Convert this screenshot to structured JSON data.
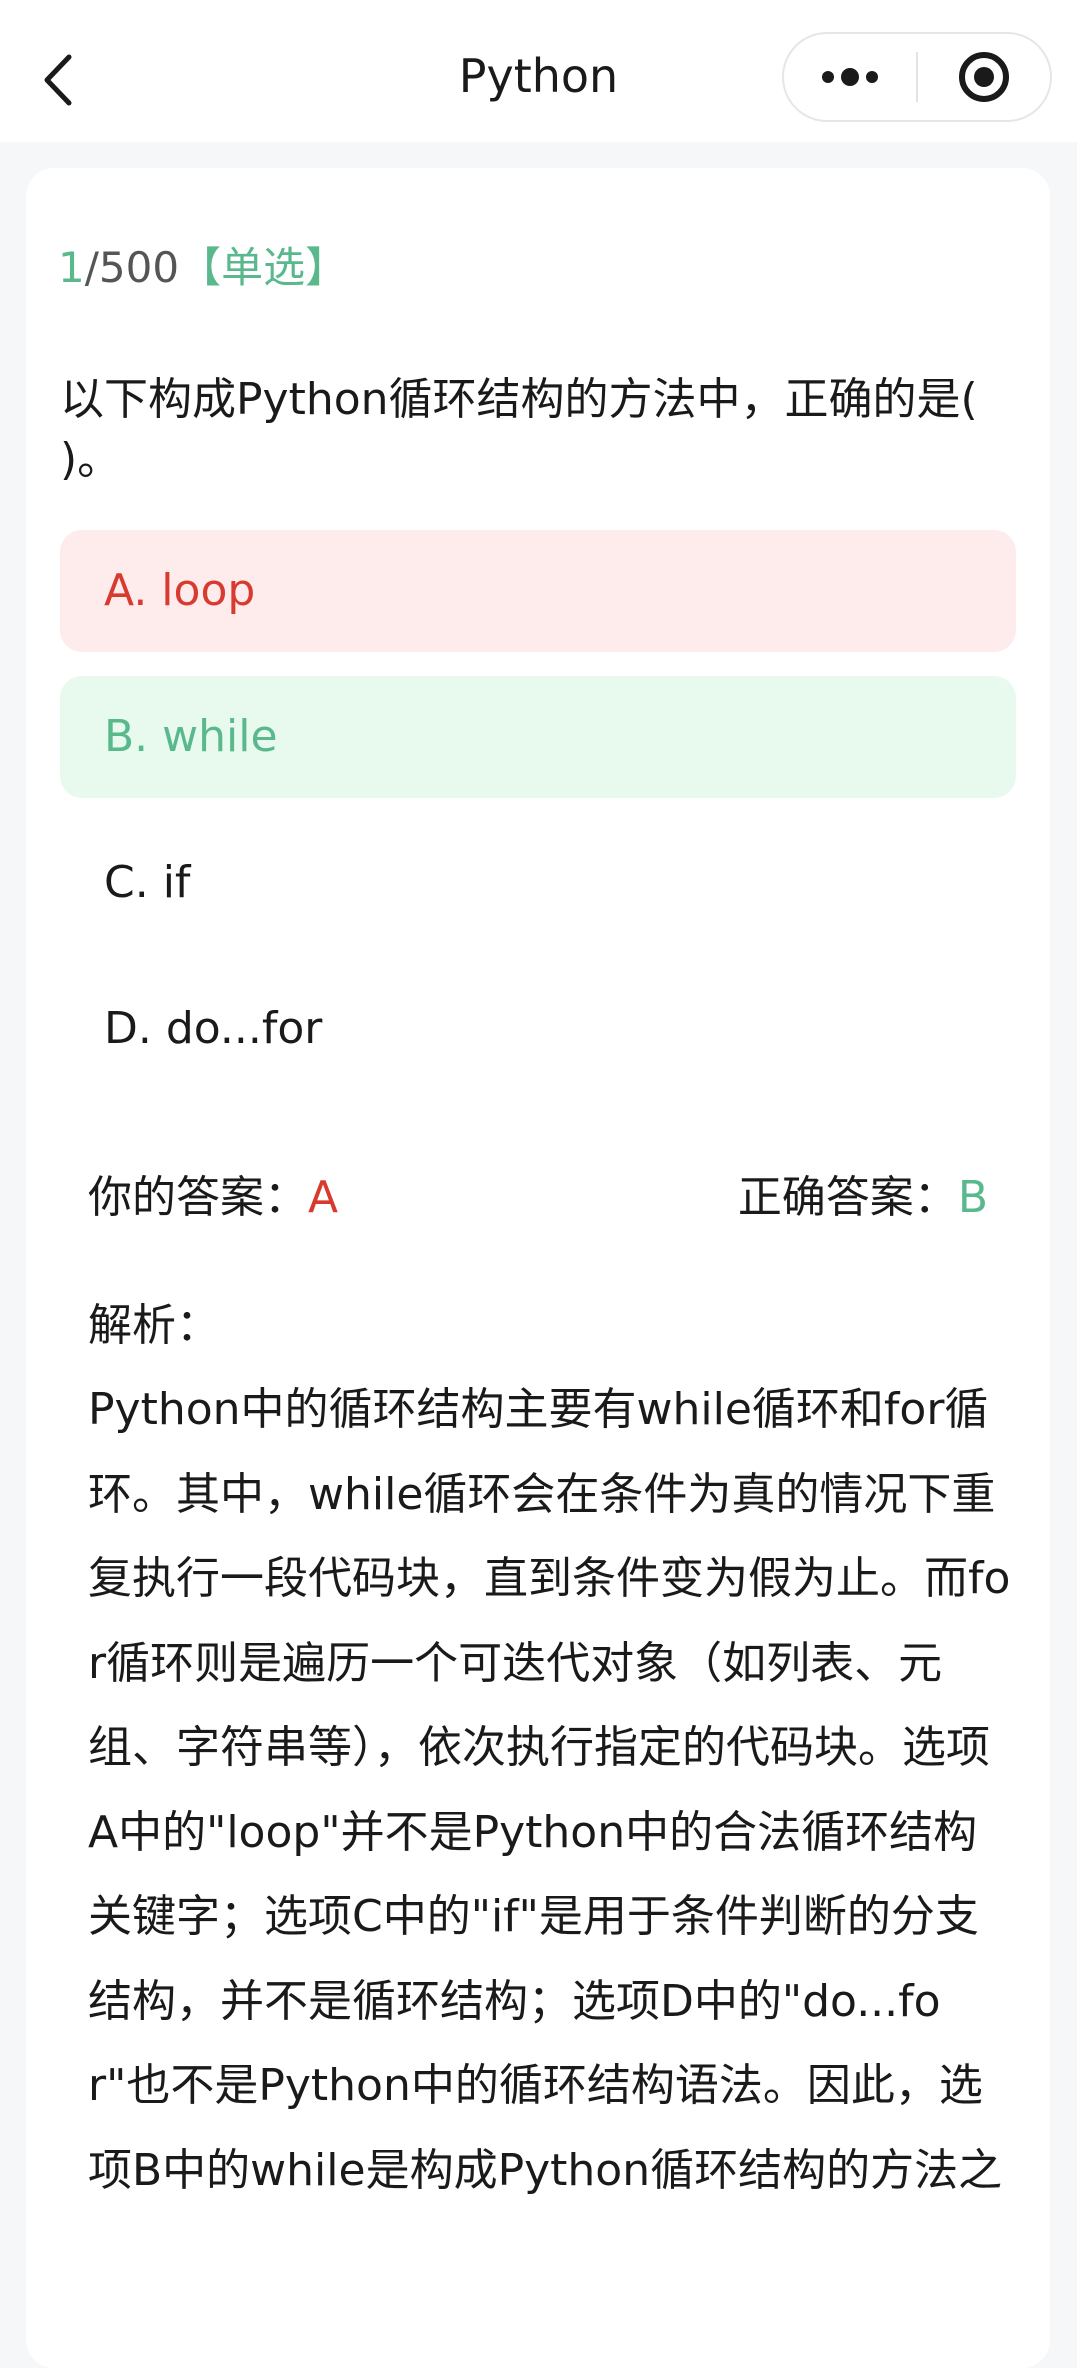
{
  "nav": {
    "title": "Python",
    "icons": {
      "back": "chevron-left-icon",
      "more": "more-dots-icon",
      "close": "target-close-icon"
    }
  },
  "question": {
    "progress_current": "1",
    "progress_total": "/500",
    "type": "【单选】",
    "text": "以下构成Python循环结构的方法中，正确的是( )。"
  },
  "options": [
    {
      "label": "A. loop",
      "state": "wrong"
    },
    {
      "label": "B. while",
      "state": "correct"
    },
    {
      "label": "C. if",
      "state": "normal"
    },
    {
      "label": "D. do...for",
      "state": "normal"
    }
  ],
  "answers": {
    "yours_label": "你的答案：",
    "yours_value": "A",
    "correct_label": "正确答案：",
    "correct_value": "B"
  },
  "analysis": {
    "label": "解析：",
    "text": "Python中的循环结构主要有while循环和for循环。其中，while循环会在条件为真的情况下重复执行一段代码块，直到条件变为假为止。而for循环则是遍历一个可迭代对象（如列表、元组、字符串等），依次执行指定的代码块。选项A中的\"loop\"并不是Python中的合法循环结构关键字；选项C中的\"if\"是用于条件判断的分支结构，并不是循环结构；选项D中的\"do...for\"也不是Python中的循环结构语法。因此，选项B中的while是构成Python循环结构的方法之"
  },
  "colors": {
    "accent_green": "#59b98c",
    "error_red": "#d93a30",
    "wrong_bg": "#fdeceb",
    "right_bg": "#e8faee"
  }
}
